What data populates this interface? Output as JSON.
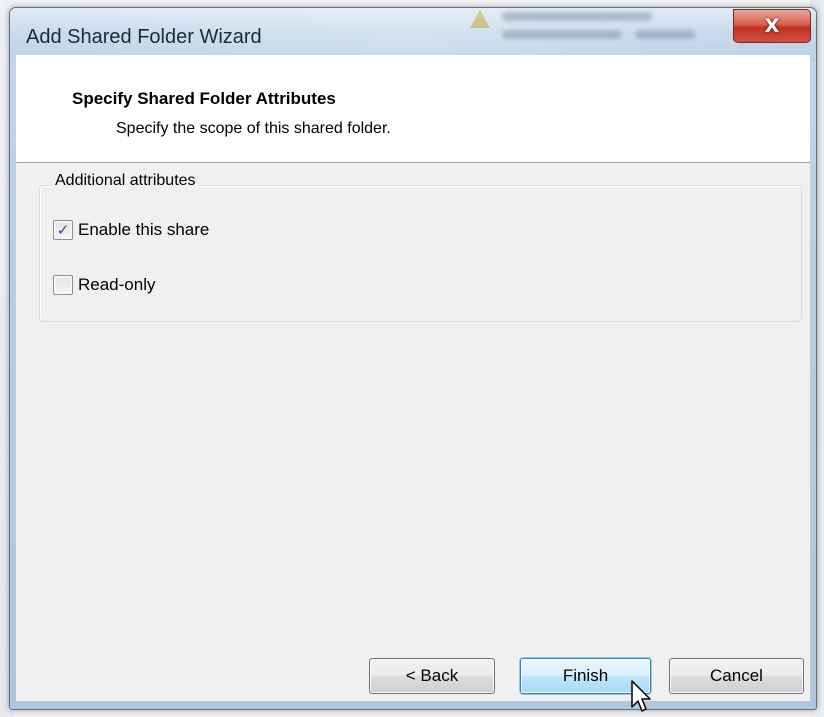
{
  "window": {
    "title": "Add Shared Folder Wizard",
    "close_label": "X"
  },
  "header": {
    "title": "Specify Shared Folder Attributes",
    "subtitle": "Specify the scope of this shared folder."
  },
  "attributes": {
    "group_label": "Additional attributes",
    "options": [
      {
        "label": "Enable this share",
        "checked": true
      },
      {
        "label": "Read-only",
        "checked": false
      }
    ]
  },
  "buttons": {
    "back": "< Back",
    "finish": "Finish",
    "cancel": "Cancel"
  },
  "colors": {
    "accent": "#3c7fb1",
    "close": "#c2311f",
    "checkmark": "#2d4f8c"
  },
  "icons": {
    "close": "close-icon",
    "check": "checkmark-icon",
    "cursor": "mouse-pointer-icon"
  }
}
